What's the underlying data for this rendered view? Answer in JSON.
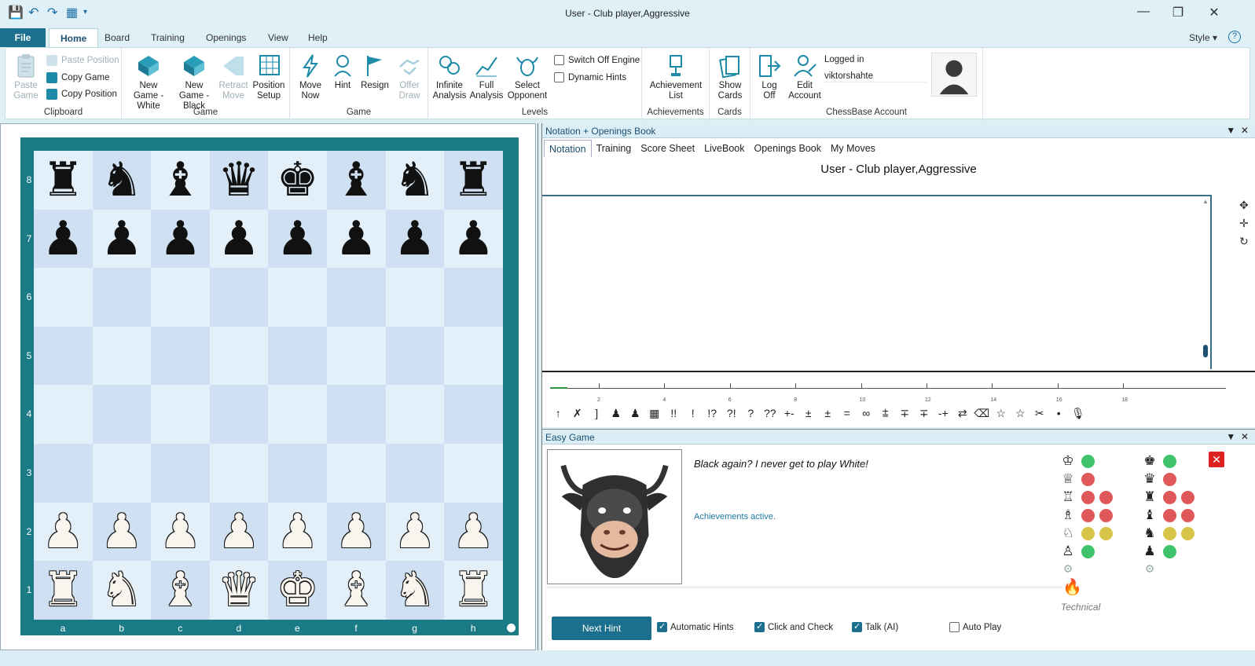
{
  "window": {
    "title": "User - Club player,Aggressive",
    "controls": [
      "—",
      "❐",
      "✕"
    ]
  },
  "quick_access": [
    "💾",
    "↶",
    "↷",
    "▦",
    "▾"
  ],
  "menu": {
    "file": "File",
    "tabs": [
      "Home",
      "Board",
      "Training",
      "Openings",
      "View",
      "Help"
    ],
    "style": "Style",
    "help_icon": "?"
  },
  "ribbon": {
    "clipboard": {
      "label": "Clipboard",
      "paste_game": "Paste Game",
      "paste_position": "Paste Position",
      "copy_game": "Copy Game",
      "copy_position": "Copy Position"
    },
    "game1": {
      "label": "Game",
      "new_white": "New Game - White",
      "new_black": "New Game - Black",
      "retract": "Retract Move",
      "position_setup": "Position Setup"
    },
    "game2": {
      "label": "Game",
      "move_now": "Move Now",
      "hint": "Hint",
      "resign": "Resign",
      "offer_draw": "Offer Draw"
    },
    "levels": {
      "label": "Levels",
      "infinite": "Infinite Analysis",
      "full": "Full Analysis",
      "select_opponent": "Select Opponent",
      "switch_off_engine": "Switch Off Engine",
      "dynamic_hints": "Dynamic Hints"
    },
    "achievements": {
      "label": "Achievements",
      "list": "Achievement List"
    },
    "cards": {
      "label": "Cards",
      "show": "Show Cards"
    },
    "account": {
      "label": "ChessBase Account",
      "log_off": "Log Off",
      "edit": "Edit Account",
      "status": "Logged in",
      "username": "viktorshahte"
    }
  },
  "board": {
    "ranks": [
      "8",
      "7",
      "6",
      "5",
      "4",
      "3",
      "2",
      "1"
    ],
    "files": [
      "a",
      "b",
      "c",
      "d",
      "e",
      "f",
      "g",
      "h"
    ],
    "position": [
      [
        "bR",
        "bN",
        "bB",
        "bQ",
        "bK",
        "bB",
        "bN",
        "bR"
      ],
      [
        "bP",
        "bP",
        "bP",
        "bP",
        "bP",
        "bP",
        "bP",
        "bP"
      ],
      [
        "",
        "",
        "",
        "",
        "",
        "",
        "",
        ""
      ],
      [
        "",
        "",
        "",
        "",
        "",
        "",
        "",
        ""
      ],
      [
        "",
        "",
        "",
        "",
        "",
        "",
        "",
        ""
      ],
      [
        "",
        "",
        "",
        "",
        "",
        "",
        "",
        ""
      ],
      [
        "wP",
        "wP",
        "wP",
        "wP",
        "wP",
        "wP",
        "wP",
        "wP"
      ],
      [
        "wR",
        "wN",
        "wB",
        "wQ",
        "wK",
        "wB",
        "wN",
        "wR"
      ]
    ]
  },
  "notation": {
    "header": "Notation + Openings Book",
    "tabs": [
      "Notation",
      "Training",
      "Score Sheet",
      "LiveBook",
      "Openings Book",
      "My Moves"
    ],
    "game_title": "User - Club player,Aggressive",
    "timeline_labels": [
      "2",
      "4",
      "6",
      "8",
      "10",
      "12",
      "14",
      "16",
      "18"
    ],
    "symbols": [
      "↑",
      "✗",
      "]",
      "♟",
      "♟",
      "▦",
      "!!",
      "!",
      "!?",
      "?!",
      "?",
      "??",
      "+-",
      "±",
      "±",
      "=",
      "∞",
      "⩲",
      "∓",
      "∓",
      "-+",
      "⇄",
      "⌫",
      "☆",
      "☆",
      "✂",
      "•",
      "🎙"
    ]
  },
  "easy_game": {
    "header": "Easy Game",
    "quote": "Black again? I never get to play White!",
    "achievements": "Achievements active.",
    "next_hint": "Next Hint",
    "options": [
      {
        "label": "Automatic Hints",
        "checked": true
      },
      {
        "label": "Click and Check",
        "checked": true
      },
      {
        "label": "Talk (AI)",
        "checked": true
      },
      {
        "label": "Auto Play",
        "checked": false
      }
    ],
    "white_pieces": [
      {
        "piece": "♔",
        "dots": [
          "green"
        ]
      },
      {
        "piece": "♕",
        "dots": [
          "red"
        ]
      },
      {
        "piece": "♖",
        "dots": [
          "red",
          "red"
        ]
      },
      {
        "piece": "♗",
        "dots": [
          "red",
          "red"
        ]
      },
      {
        "piece": "♘",
        "dots": [
          "yellow",
          "yellow"
        ]
      },
      {
        "piece": "♙",
        "dots": [
          "green"
        ]
      }
    ],
    "black_pieces": [
      {
        "piece": "♚",
        "dots": [
          "green"
        ]
      },
      {
        "piece": "♛",
        "dots": [
          "red"
        ]
      },
      {
        "piece": "♜",
        "dots": [
          "red",
          "red"
        ]
      },
      {
        "piece": "♝",
        "dots": [
          "red",
          "red"
        ]
      },
      {
        "piece": "♞",
        "dots": [
          "yellow",
          "yellow"
        ]
      },
      {
        "piece": "♟",
        "dots": [
          "green"
        ]
      }
    ],
    "style_label": "Technical"
  }
}
